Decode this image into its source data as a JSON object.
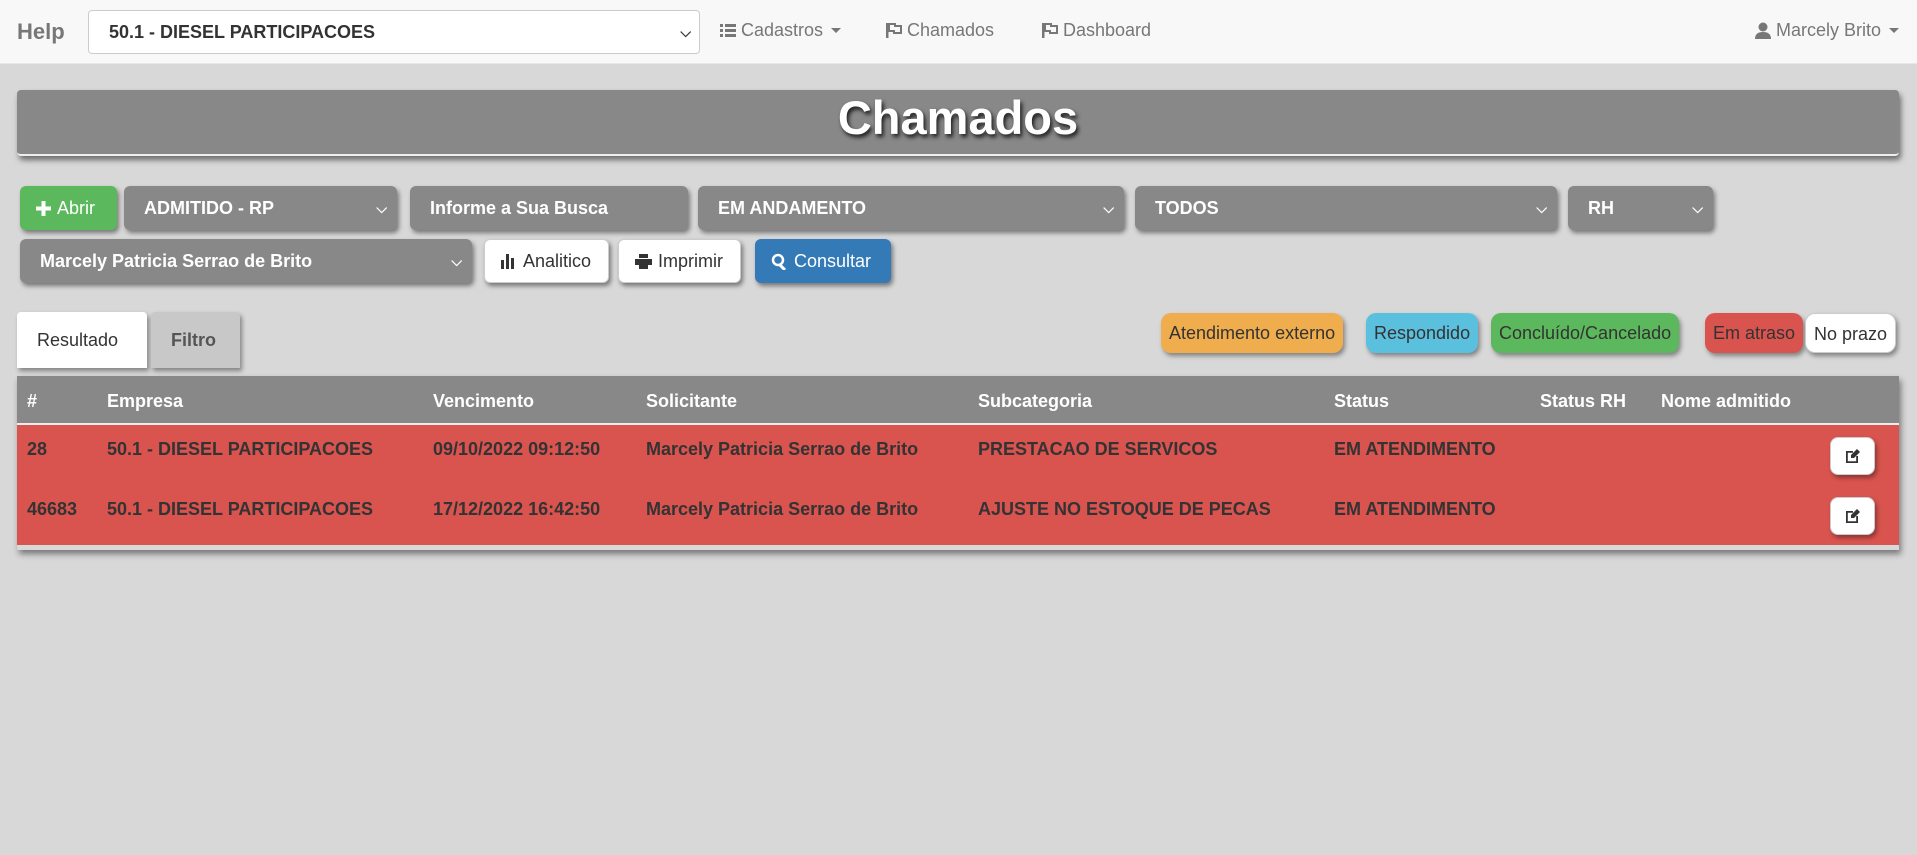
{
  "navbar": {
    "brand": "Help",
    "company_select": "50.1 - DIESEL PARTICIPACOES",
    "links": [
      {
        "label": "Cadastros",
        "icon": "list-icon"
      },
      {
        "label": "Chamados",
        "icon": "flag-icon"
      },
      {
        "label": "Dashboard",
        "icon": "flag-icon"
      }
    ],
    "user": "Marcely Brito"
  },
  "page": {
    "title": "Chamados"
  },
  "filters": {
    "open_button": "Abrir",
    "type_select": "ADMITIDO - RP",
    "search_placeholder": "Informe a Sua Busca",
    "status_select": "EM ANDAMENTO",
    "all_select": "TODOS",
    "dept_select": "RH",
    "requester_select": "Marcely Patricia Serrao de Brito",
    "analytic_button": "Analitico",
    "print_button": "Imprimir",
    "query_button": "Consultar"
  },
  "tabs": [
    "Resultado",
    "Filtro"
  ],
  "legend": [
    {
      "label": "Atendimento externo",
      "color": "#f0ad4e"
    },
    {
      "label": "Respondido",
      "color": "#5bc0de"
    },
    {
      "label": "Concluído/Cancelado",
      "color": "#5cb85c"
    },
    {
      "label": "Em atraso",
      "color": "#d9534f"
    },
    {
      "label": "No prazo",
      "color": "#ffffff"
    }
  ],
  "table": {
    "headers": [
      "#",
      "Empresa",
      "Vencimento",
      "Solicitante",
      "Subcategoria",
      "Status",
      "Status RH",
      "Nome admitido"
    ],
    "rows": [
      [
        "28",
        "50.1 - DIESEL PARTICIPACOES",
        "09/10/2022 09:12:50",
        "Marcely Patricia Serrao de Brito",
        "PRESTACAO DE SERVICOS",
        "EM ATENDIMENTO",
        "",
        ""
      ],
      [
        "46683",
        "50.1 - DIESEL PARTICIPACOES",
        "17/12/2022 16:42:50",
        "Marcely Patricia Serrao de Brito",
        "AJUSTE NO ESTOQUE DE PECAS",
        "EM ATENDIMENTO",
        "",
        ""
      ]
    ]
  }
}
